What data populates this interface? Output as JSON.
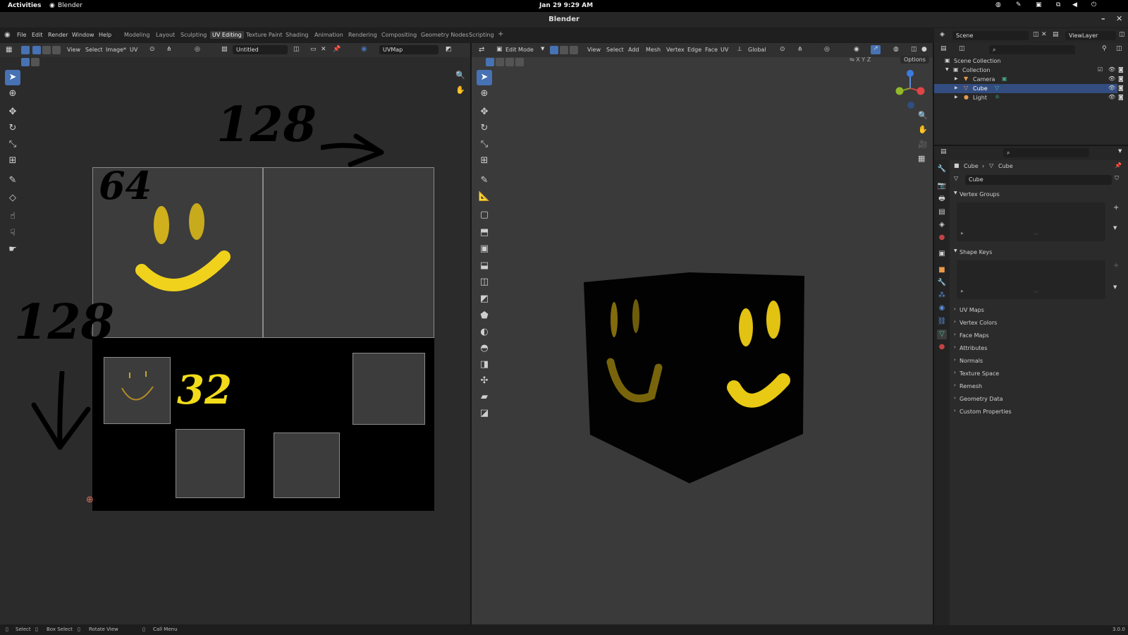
{
  "system_bar": {
    "activities": "Activities",
    "app": "Blender",
    "datetime": "Jan 29  9:29 AM"
  },
  "window": {
    "title": "Blender"
  },
  "menu": {
    "items": [
      "File",
      "Edit",
      "Render",
      "Window",
      "Help"
    ],
    "workspaces": [
      "Modeling",
      "Layout",
      "Sculpting",
      "UV Editing",
      "Texture Paint",
      "Shading",
      "Animation",
      "Rendering",
      "Compositing",
      "Geometry Nodes",
      "Scripting"
    ],
    "active_workspace": "UV Editing",
    "add_tab": "+"
  },
  "uv_editor": {
    "header_menus": [
      "View",
      "Select",
      "Image*",
      "UV"
    ],
    "image_name": "Untitled",
    "uv_map": "UVMap",
    "annotations": {
      "width_top": "128",
      "height_left": "128",
      "face_size": "64",
      "small_size": "32"
    }
  },
  "viewport": {
    "mode": "Edit Mode",
    "header_menus": [
      "View",
      "Select",
      "Add",
      "Mesh",
      "Vertex",
      "Edge",
      "Face",
      "UV"
    ],
    "orientation": "Global",
    "options": "Options",
    "axes": [
      "X",
      "Y",
      "Z"
    ]
  },
  "outliner": {
    "scene": "Scene",
    "view_layer": "ViewLayer",
    "root": "Scene Collection",
    "collection": "Collection",
    "items": [
      {
        "name": "Camera",
        "selected": false
      },
      {
        "name": "Cube",
        "selected": true
      },
      {
        "name": "Light",
        "selected": false
      }
    ]
  },
  "properties": {
    "breadcrumb": [
      "Cube",
      "Cube"
    ],
    "mesh_name": "Cube",
    "panels_open": [
      "Vertex Groups",
      "Shape Keys"
    ],
    "panels_closed": [
      "UV Maps",
      "Vertex Colors",
      "Face Maps",
      "Attributes",
      "Normals",
      "Texture Space",
      "Remesh",
      "Geometry Data",
      "Custom Properties"
    ]
  },
  "status_bar": {
    "items": [
      "Select",
      "Box Select",
      "Rotate View",
      "Call Menu"
    ],
    "version": "3.0.0"
  },
  "colors": {
    "accent": "#4772b3",
    "smiley": "#e8c91a",
    "bg": "#2b2b2b"
  }
}
